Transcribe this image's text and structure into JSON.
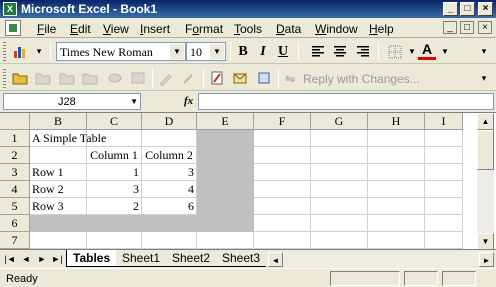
{
  "window": {
    "title": "Microsoft Excel - Book1"
  },
  "menu": [
    {
      "label": "File",
      "u": "F"
    },
    {
      "label": "Edit",
      "u": "E"
    },
    {
      "label": "View",
      "u": "V"
    },
    {
      "label": "Insert",
      "u": "I"
    },
    {
      "label": "Format",
      "u": "o"
    },
    {
      "label": "Tools",
      "u": "T"
    },
    {
      "label": "Data",
      "u": "D"
    },
    {
      "label": "Window",
      "u": "W"
    },
    {
      "label": "Help",
      "u": "H"
    }
  ],
  "format_toolbar": {
    "font_name": "Times New Roman",
    "font_size": "10",
    "bold": "B",
    "italic": "I",
    "underline": "U",
    "font_color_glyph": "A"
  },
  "review_toolbar": {
    "reply_label": "Reply with Changes..."
  },
  "formula_bar": {
    "name_box": "J28",
    "fx": "fx",
    "formula": ""
  },
  "columns": [
    "B",
    "C",
    "D",
    "E",
    "F",
    "G",
    "H",
    "I"
  ],
  "rows": [
    "1",
    "2",
    "3",
    "4",
    "5",
    "6",
    "7"
  ],
  "cells": {
    "r1": [
      "A Simple Table",
      "",
      "",
      "",
      "",
      "",
      "",
      ""
    ],
    "r2": [
      "",
      "Column 1",
      "Column 2",
      "",
      "",
      "",
      "",
      ""
    ],
    "r3": [
      "Row 1",
      "1",
      "3",
      "",
      "",
      "",
      "",
      ""
    ],
    "r4": [
      "Row 2",
      "3",
      "4",
      "",
      "",
      "",
      "",
      ""
    ],
    "r5": [
      "Row 3",
      "2",
      "6",
      "",
      "",
      "",
      "",
      ""
    ],
    "r6": [
      "",
      "",
      "",
      "",
      "",
      "",
      "",
      ""
    ],
    "r7": [
      "",
      "",
      "",
      "",
      "",
      "",
      "",
      ""
    ]
  },
  "sheets": [
    "Tables",
    "Sheet1",
    "Sheet2",
    "Sheet3"
  ],
  "status": {
    "text": "Ready"
  },
  "colors": {
    "title_bar": "#0a246a",
    "gray_fill": "#c0c0c0",
    "chrome": "#ece9d8"
  }
}
